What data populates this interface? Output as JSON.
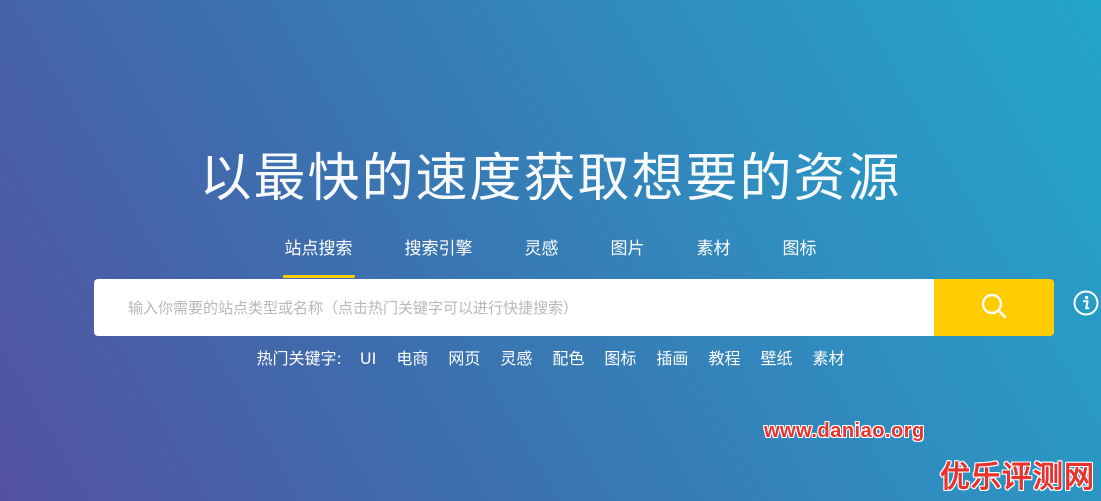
{
  "hero": {
    "title": "以最快的速度获取想要的资源"
  },
  "tabs": [
    {
      "label": "站点搜索",
      "active": true
    },
    {
      "label": "搜索引擎",
      "active": false
    },
    {
      "label": "灵感",
      "active": false
    },
    {
      "label": "图片",
      "active": false
    },
    {
      "label": "素材",
      "active": false
    },
    {
      "label": "图标",
      "active": false
    }
  ],
  "search": {
    "value": "",
    "placeholder": "输入你需要的站点类型或名称（点击热门关键字可以进行快捷搜索）",
    "button_icon": "search-icon"
  },
  "info_icon": "info-icon",
  "hot": {
    "label": "热门关键字:",
    "keywords": [
      "UI",
      "电商",
      "网页",
      "灵感",
      "配色",
      "图标",
      "插画",
      "教程",
      "壁纸",
      "素材"
    ]
  },
  "watermark": {
    "url": "www.daniao.org",
    "brand": "优乐评测网"
  },
  "colors": {
    "accent": "#ffcc00",
    "watermark": "#e8322d",
    "gradient_start": "#5452a0",
    "gradient_end": "#22a6c8"
  }
}
